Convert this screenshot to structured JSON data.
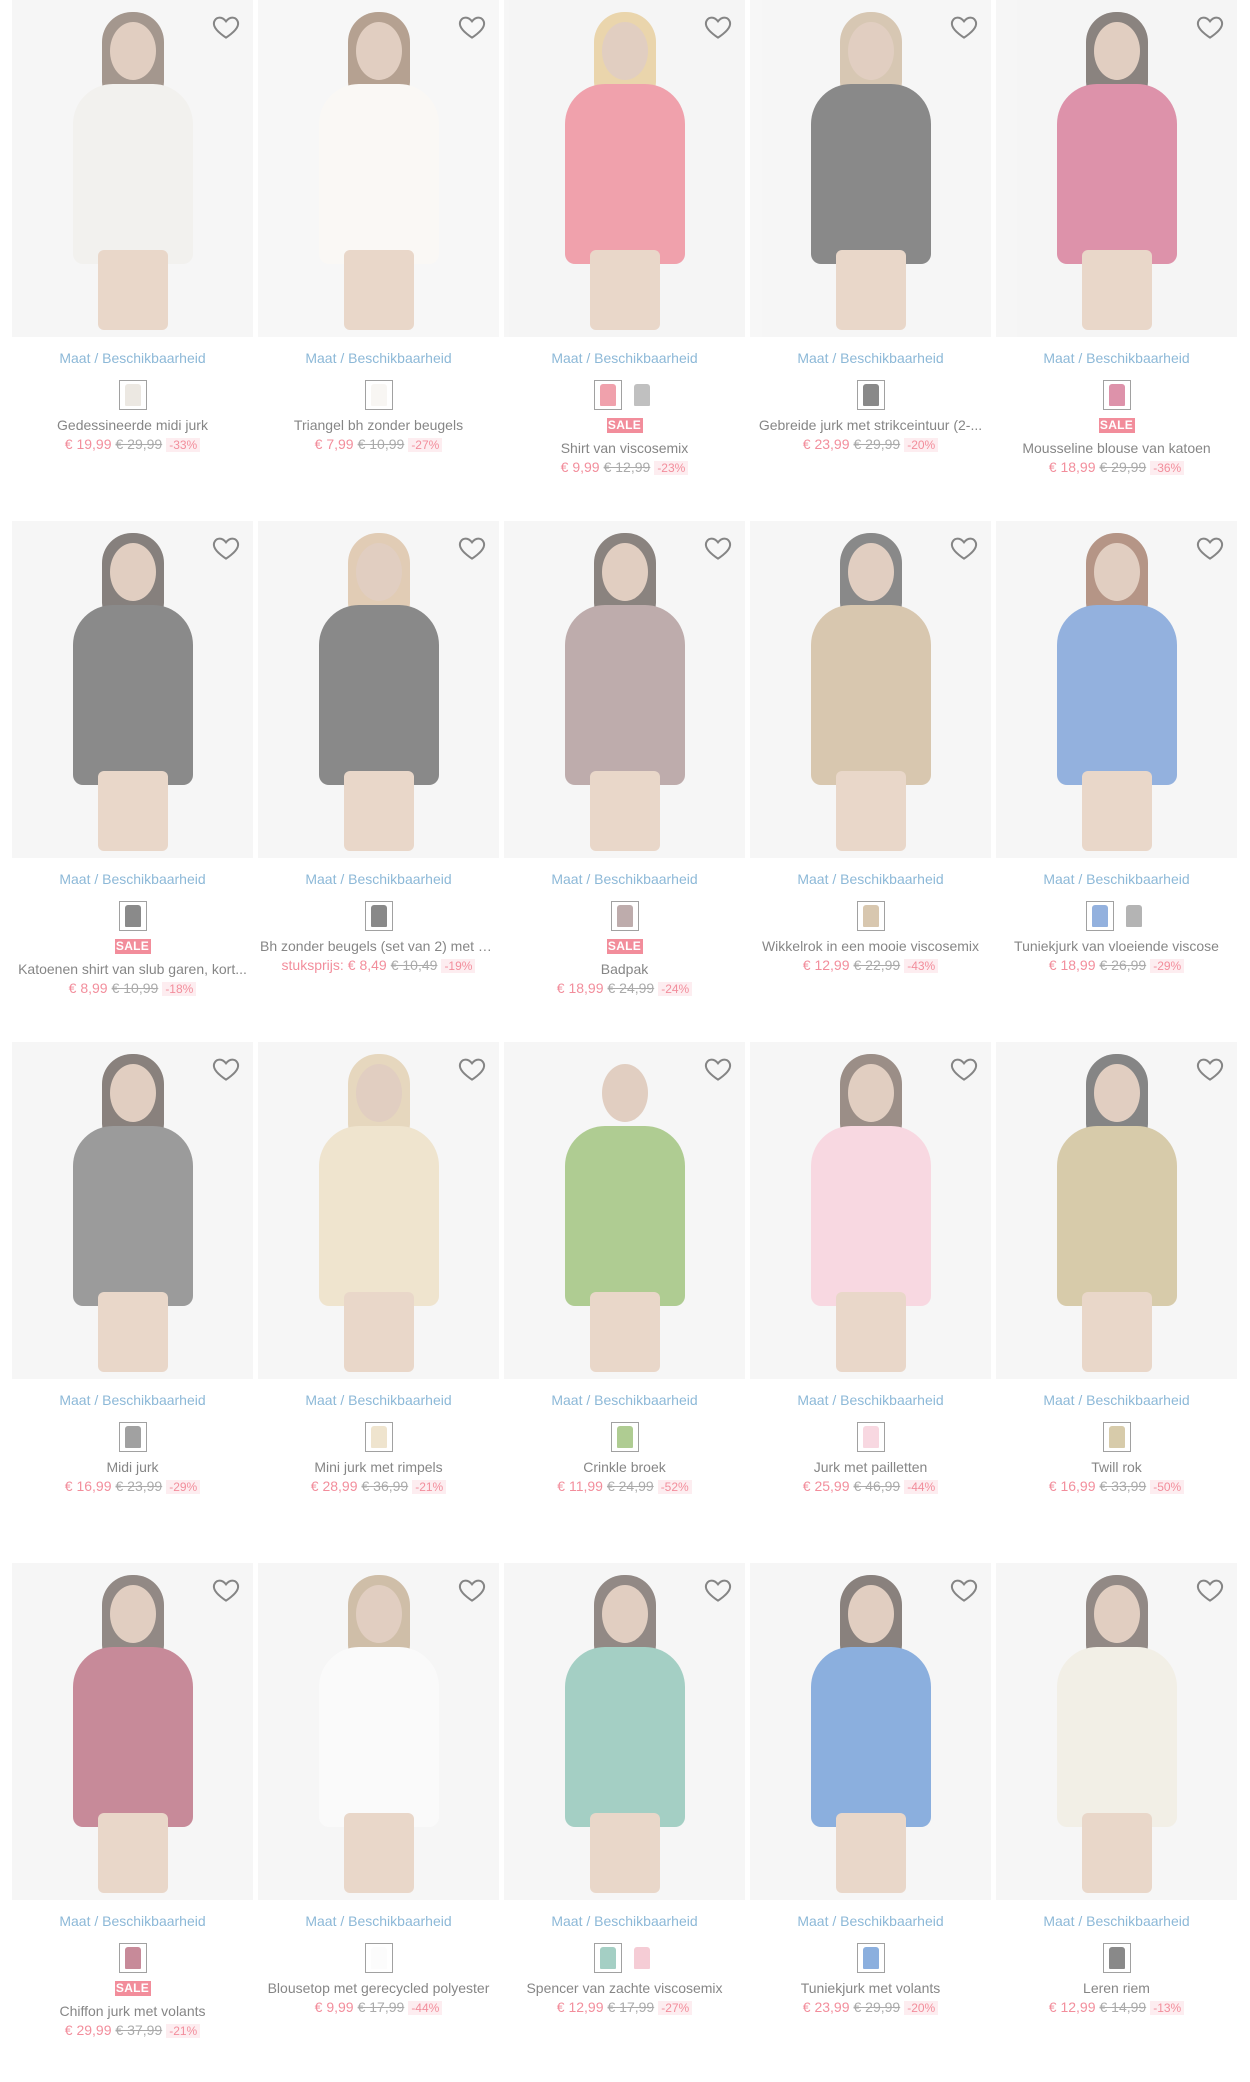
{
  "availability_label": "Maat / Beschikbaarheid",
  "sale_label": "SALE",
  "products": [
    {
      "name": "Gedessineerde midi jurk",
      "price": "€ 19,99",
      "old": "€ 29,99",
      "disc": "-33%",
      "sale": false,
      "swatches": [
        "#ddd6cc"
      ],
      "bg": "#f0f0f0",
      "body": "#e9e6e1",
      "hair": "#5b4333"
    },
    {
      "name": "Triangel bh zonder beugels",
      "price": "€ 7,99",
      "old": "€ 10,99",
      "disc": "-27%",
      "sale": false,
      "swatches": [
        "#f3f0ea"
      ],
      "bg": "#f1f1f1",
      "body": "#f6f3ee",
      "hair": "#7a5638"
    },
    {
      "name": "Shirt van viscosemix",
      "price": "€ 9,99",
      "old": "€ 12,99",
      "disc": "-23%",
      "sale": true,
      "swatches": [
        "#e4566a",
        "#8e8e8e"
      ],
      "bg": "#eeeeee",
      "body": "#e4566a",
      "hair": "#d9b46a"
    },
    {
      "name": "Gebreide jurk met strikceintuur (2-...",
      "price": "€ 23,99",
      "old": "€ 29,99",
      "disc": "-20%",
      "sale": false,
      "swatches": [
        "#2a2a2a"
      ],
      "bg": "#f0f0f0",
      "body": "#2a2a2a",
      "hair": "#b89a76"
    },
    {
      "name": "Mousseline blouse van katoen",
      "price": "€ 18,99",
      "old": "€ 29,99",
      "disc": "-36%",
      "sale": true,
      "swatches": [
        "#c23a66"
      ],
      "bg": "#eeeeee",
      "body": "#c23a66",
      "hair": "#2c1e17"
    },
    {
      "name": "Katoenen shirt van slub garen, kort...",
      "price": "€ 8,99",
      "old": "€ 10,99",
      "disc": "-18%",
      "sale": true,
      "swatches": [
        "#2b2b2b"
      ],
      "bg": "#efefef",
      "body": "#2b2b2b",
      "hair": "#241a14"
    },
    {
      "name": "Bh zonder beugels (set van 2) met b...",
      "price": "€ 8,49",
      "old": "€ 10,49",
      "disc": "-19%",
      "sale": false,
      "unit": "stuksprijs:",
      "swatches": [
        "#2a2a2a"
      ],
      "bg": "#efefef",
      "body": "#2a2a2a",
      "hair": "#c9a37a"
    },
    {
      "name": "Badpak",
      "price": "€ 18,99",
      "old": "€ 24,99",
      "disc": "-24%",
      "sale": true,
      "swatches": [
        "#8a6a6a"
      ],
      "bg": "#efefef",
      "body": "#8a6a6a",
      "hair": "#2c1e17"
    },
    {
      "name": "Wikkelrok in een mooie viscosemix",
      "price": "€ 12,99",
      "old": "€ 22,99",
      "disc": "-43%",
      "sale": false,
      "swatches": [
        "#b99a6e"
      ],
      "bg": "#efefef",
      "body": "#b99a6e",
      "hair": "#2a2a2a"
    },
    {
      "name": "Tuniekjurk van vloeiende viscose",
      "price": "€ 18,99",
      "old": "€ 26,99",
      "disc": "-29%",
      "sale": false,
      "swatches": [
        "#3c73c4",
        "#777777"
      ],
      "bg": "#efefef",
      "body": "#3c73c4",
      "hair": "#7a3f24"
    },
    {
      "name": "Midi jurk",
      "price": "€ 16,99",
      "old": "€ 23,99",
      "disc": "-29%",
      "sale": false,
      "swatches": [
        "#555555"
      ],
      "bg": "#efefef",
      "body": "#4a4a4a",
      "hair": "#2a1c14"
    },
    {
      "name": "Mini jurk met rimpels",
      "price": "€ 28,99",
      "old": "€ 36,99",
      "disc": "-21%",
      "sale": false,
      "swatches": [
        "#e2cfa7"
      ],
      "bg": "#efefef",
      "body": "#e2cfa7",
      "hair": "#d2b789"
    },
    {
      "name": "Crinkle broek",
      "price": "€ 11,99",
      "old": "€ 24,99",
      "disc": "-52%",
      "sale": false,
      "swatches": [
        "#6fa33a"
      ],
      "bg": "#efefef",
      "body": "#6fa33a",
      "hair": "#efefef"
    },
    {
      "name": "Jurk met pailletten",
      "price": "€ 25,99",
      "old": "€ 46,99",
      "disc": "-44%",
      "sale": false,
      "swatches": [
        "#f4b9c9"
      ],
      "bg": "#efefef",
      "body": "#f4b9c9",
      "hair": "#4a3226"
    },
    {
      "name": "Twill rok",
      "price": "€ 16,99",
      "old": "€ 33,99",
      "disc": "-50%",
      "sale": false,
      "swatches": [
        "#b8a165"
      ],
      "bg": "#efefef",
      "body": "#b8a165",
      "hair": "#222222"
    },
    {
      "name": "Chiffon jurk met volants",
      "price": "€ 29,99",
      "old": "€ 37,99",
      "disc": "-21%",
      "sale": true,
      "swatches": [
        "#9b2c46"
      ],
      "bg": "#efefef",
      "body": "#9b2c46",
      "hair": "#3a2a22"
    },
    {
      "name": "Blousetop met gerecycled polyester",
      "price": "€ 9,99",
      "old": "€ 17,99",
      "disc": "-44%",
      "sale": false,
      "swatches": [
        "#fafafa"
      ],
      "bg": "#efefef",
      "body": "#f7f7f7",
      "hair": "#a98a62"
    },
    {
      "name": "Spencer van zachte viscosemix",
      "price": "€ 12,99",
      "old": "€ 17,99",
      "disc": "-27%",
      "sale": false,
      "swatches": [
        "#5ba994",
        "#eea3b3"
      ],
      "bg": "#efefef",
      "body": "#5ba994",
      "hair": "#3a2a22"
    },
    {
      "name": "Tuniekjurk met volants",
      "price": "€ 23,99",
      "old": "€ 29,99",
      "disc": "-20%",
      "sale": false,
      "swatches": [
        "#2d6fc4"
      ],
      "bg": "#efefef",
      "body": "#2d6fc4",
      "hair": "#2a1c14"
    },
    {
      "name": "Leren riem",
      "price": "€ 12,99",
      "old": "€ 14,99",
      "disc": "-13%",
      "sale": false,
      "swatches": [
        "#2a2a2a"
      ],
      "bg": "#efefef",
      "body": "#e9e2d2",
      "hair": "#3a2a22"
    }
  ]
}
